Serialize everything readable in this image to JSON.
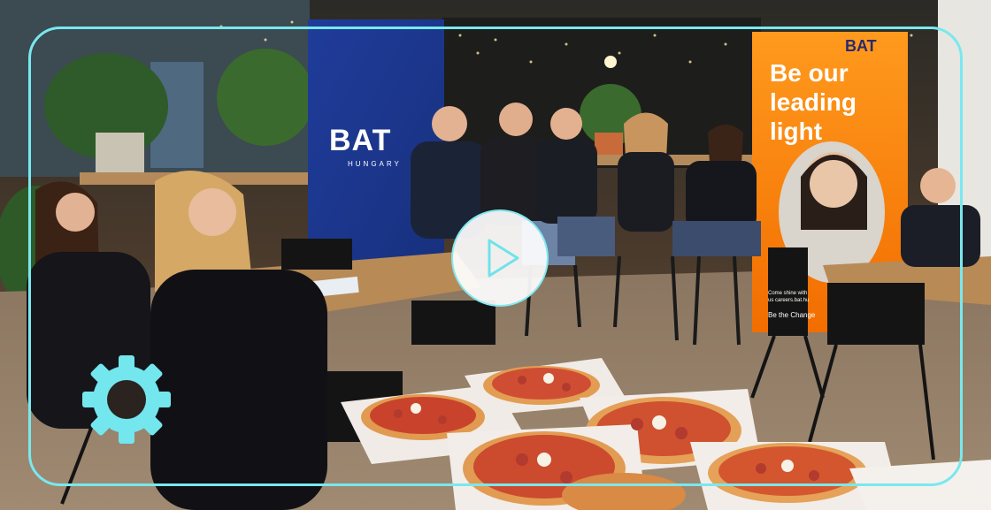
{
  "video_player": {
    "play_label": "Play video",
    "settings_label": "Settings",
    "accent_color": "#79e8ef"
  },
  "scene": {
    "left_banner": {
      "logo": "BAT",
      "subtitle": "HUNGARY"
    },
    "right_banner": {
      "logo": "BAT",
      "headline_line1": "Be our",
      "headline_line2": "leading",
      "headline_line3": "light",
      "small_text": "Come shine with us careers.bat.hu",
      "cta": "Be the Change"
    }
  }
}
